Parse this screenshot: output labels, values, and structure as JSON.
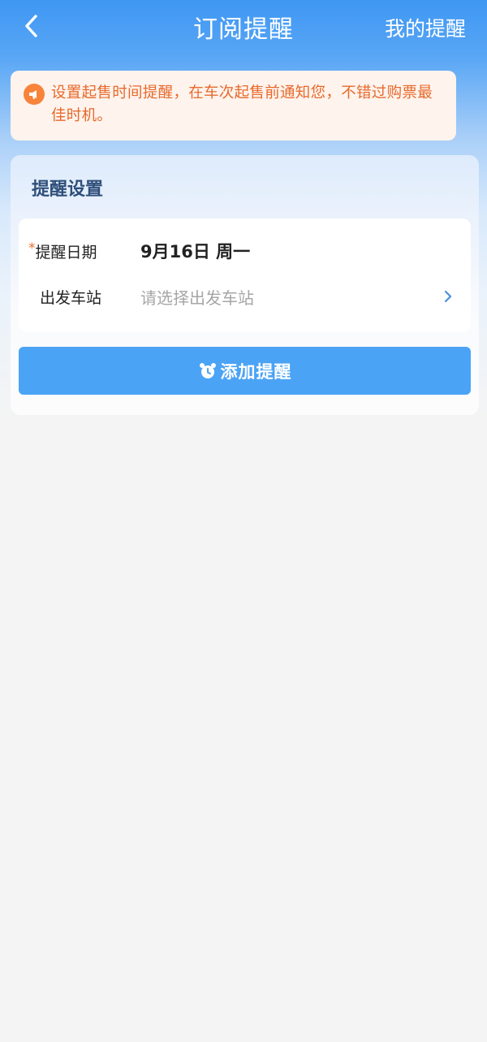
{
  "header": {
    "title": "订阅提醒",
    "right_action": "我的提醒"
  },
  "notice": {
    "text": "设置起售时间提醒，在车次起售前通知您，不错过购票最佳时机。",
    "icon": "megaphone-icon"
  },
  "settings": {
    "title": "提醒设置",
    "date_label": "提醒日期",
    "date_value": "9月16日 周一",
    "station_label": "出发车站",
    "station_placeholder": "请选择出发车站",
    "add_button_label": "添加提醒"
  },
  "colors": {
    "header_blue": "#3f97f3",
    "button_blue": "#4ba3f5",
    "notice_orange": "#e76a2c",
    "title_navy": "#2f4f7a"
  }
}
